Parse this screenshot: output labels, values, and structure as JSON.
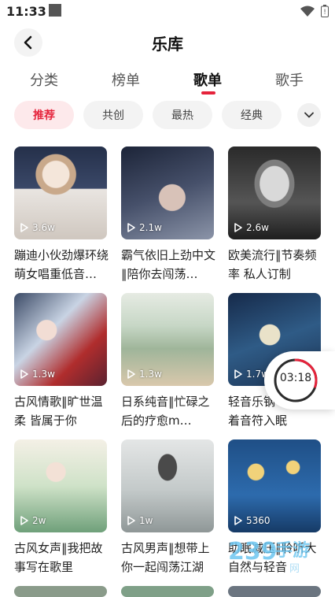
{
  "status_bar": {
    "time": "11:33"
  },
  "header": {
    "title": "乐库"
  },
  "tabs": [
    {
      "label": "分类"
    },
    {
      "label": "榜单"
    },
    {
      "label": "歌单",
      "active": true
    },
    {
      "label": "歌手"
    }
  ],
  "filters": [
    {
      "label": "推荐",
      "active": true
    },
    {
      "label": "共创"
    },
    {
      "label": "最热"
    },
    {
      "label": "经典"
    }
  ],
  "playlists": [
    {
      "title": "蹦迪小伙劲爆环绕萌女唱重低音…",
      "plays": "3.6w"
    },
    {
      "title": "霸气依旧上劲中文‖陪你去闯荡…",
      "plays": "2.1w"
    },
    {
      "title": "欧美流行‖节奏频率 私人订制",
      "plays": "2.6w"
    },
    {
      "title": "古风情歌‖旷世温柔 皆属于你",
      "plays": "1.3w"
    },
    {
      "title": "日系纯音‖忙碌之后的疗愈m…",
      "plays": "1.3w"
    },
    {
      "title": "轻音乐钢琴曲‖随着音符入眠",
      "plays": "1.7w"
    },
    {
      "title": "古风女声‖我把故事写在歌里",
      "plays": "2w"
    },
    {
      "title": "古风男声‖想带上你一起闯荡江湖",
      "plays": "1w"
    },
    {
      "title": "助眠减压‖聆听大自然与轻音",
      "plays": "5360"
    }
  ],
  "timer": {
    "label": "03:18",
    "progress": 0.3
  },
  "watermark": {
    "text": "2 3 9 手游网"
  },
  "colors": {
    "accent": "#e5233b",
    "chip_bg": "#f3f3f3",
    "chip_active_bg": "#fde9eb"
  }
}
